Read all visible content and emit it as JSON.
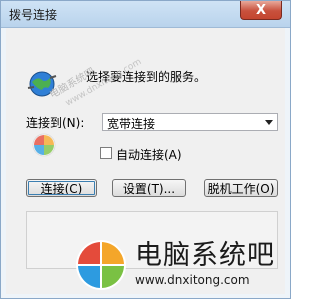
{
  "window": {
    "title": "拨号连接"
  },
  "close_button": {
    "glyph": "X"
  },
  "message": "选择要连接到的服务。",
  "connect_to": {
    "label": "连接到(N):",
    "selected_value": "宽带连接"
  },
  "auto_connect": {
    "label": "自动连接(A)",
    "checked": false
  },
  "buttons": {
    "connect": "连接(C)",
    "settings": "设置(T)...",
    "offline": "脱机工作(O)"
  },
  "watermark": {
    "brand": "电脑系统吧",
    "url": "www.dnxitong.com",
    "small_text": "电脑系统吧",
    "small_url": "www.dnxitong.com"
  },
  "colors": {
    "title_bg": "#c4dbf1",
    "close_red": "#c8513d",
    "client_bg": "#f0f0f0"
  }
}
